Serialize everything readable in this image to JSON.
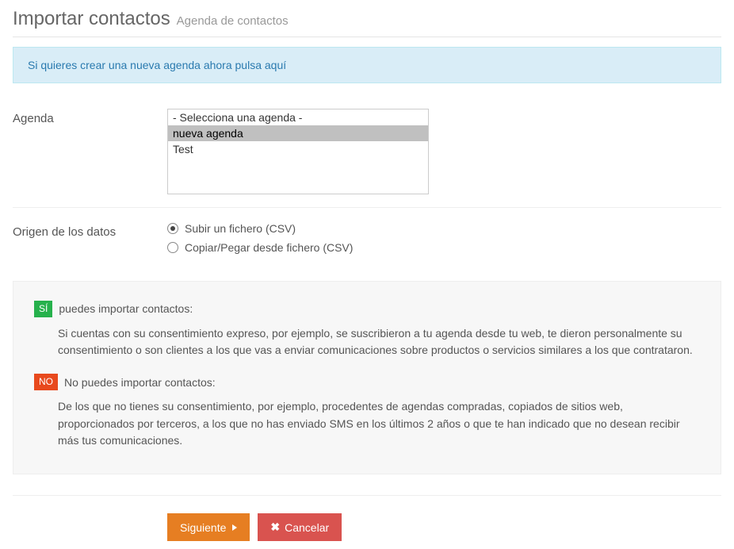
{
  "header": {
    "title": "Importar contactos",
    "subtitle": "Agenda de contactos"
  },
  "alert": {
    "link_text": "Si quieres crear una nueva agenda ahora pulsa aquí"
  },
  "form": {
    "agenda_label": "Agenda",
    "agenda_options": [
      {
        "label": "- Selecciona una agenda -",
        "selected": false
      },
      {
        "label": "nueva agenda",
        "selected": true
      },
      {
        "label": "Test",
        "selected": false
      }
    ],
    "origin_label": "Origen de los datos",
    "origin_options": [
      {
        "label": "Subir un fichero (CSV)",
        "checked": true
      },
      {
        "label": "Copiar/Pegar desde fichero (CSV)",
        "checked": false
      }
    ]
  },
  "consent": {
    "yes_badge": "SÍ",
    "yes_title": "puedes importar contactos:",
    "yes_body": "Si cuentas con su consentimiento expreso, por ejemplo, se suscribieron a tu agenda desde tu web, te dieron personalmente su consentimiento o son clientes a los que vas a enviar comunicaciones sobre productos o servicios similares a los que contrataron.",
    "no_badge": "NO",
    "no_title": "No puedes importar contactos:",
    "no_body": "De los que no tienes su consentimiento, por ejemplo, procedentes de agendas compradas, copiados de sitios web, proporcionados por terceros, a los que no has enviado SMS en los últimos 2 años o que te han indicado que no desean recibir más tus comunicaciones."
  },
  "buttons": {
    "next": "Siguiente",
    "cancel": "Cancelar"
  }
}
